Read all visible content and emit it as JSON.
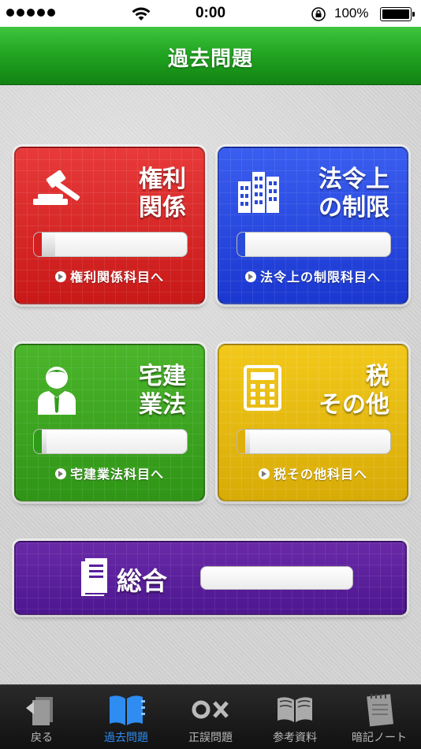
{
  "status_bar": {
    "time": "0:00",
    "battery_percent": "100%"
  },
  "header": {
    "title": "過去問題"
  },
  "tiles": [
    {
      "id": "kenri",
      "title": "権利\n関係",
      "link_label": "権利関係科目へ",
      "color": "#d62222",
      "progress": 0.14,
      "icon": "gavel-icon"
    },
    {
      "id": "hourei",
      "title": "法令上\nの制限",
      "link_label": "法令上の制限科目へ",
      "color": "#2140d8",
      "progress": 0.05,
      "icon": "building-icon"
    },
    {
      "id": "takken",
      "title": "宅建\n業法",
      "link_label": "宅建業法科目へ",
      "color": "#3aa31f",
      "progress": 0.08,
      "icon": "person-icon"
    },
    {
      "id": "zei",
      "title": "税\nその他",
      "link_label": "税その他科目へ",
      "color": "#e3b40c",
      "progress": 0.08,
      "icon": "calculator-icon"
    }
  ],
  "summary_tile": {
    "title": "総合",
    "color": "#5a1e9c",
    "progress": 0,
    "icon": "document-icon"
  },
  "tab_bar": {
    "items": [
      {
        "label": "戻る",
        "icon": "back-icon",
        "active": false
      },
      {
        "label": "過去問題",
        "icon": "book-icon",
        "active": true
      },
      {
        "label": "正誤問題",
        "icon": "ox-icon",
        "active": false
      },
      {
        "label": "参考資料",
        "icon": "open-book-icon",
        "active": false
      },
      {
        "label": "暗記ノート",
        "icon": "notebook-icon",
        "active": false
      }
    ]
  }
}
